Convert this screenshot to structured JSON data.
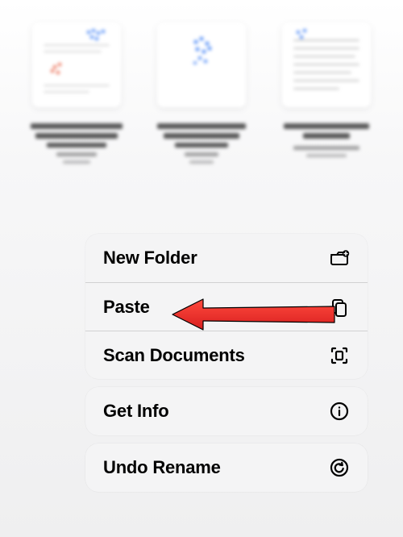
{
  "background": {
    "thumbnails": [
      {
        "name": "file-thumbnail-1"
      },
      {
        "name": "file-thumbnail-2"
      },
      {
        "name": "file-thumbnail-3"
      }
    ]
  },
  "menu": {
    "groups": [
      {
        "items": [
          {
            "label": "New Folder",
            "icon": "folder-add-icon"
          },
          {
            "label": "Paste",
            "icon": "clipboard-icon",
            "annotation_arrow": true
          },
          {
            "label": "Scan Documents",
            "icon": "scan-icon"
          }
        ]
      },
      {
        "items": [
          {
            "label": "Get Info",
            "icon": "info-icon"
          }
        ]
      },
      {
        "items": [
          {
            "label": "Undo Rename",
            "icon": "undo-icon"
          }
        ]
      }
    ]
  },
  "annotation": {
    "arrow_color": "#ed2c2c",
    "arrow_outline": "#000000"
  }
}
